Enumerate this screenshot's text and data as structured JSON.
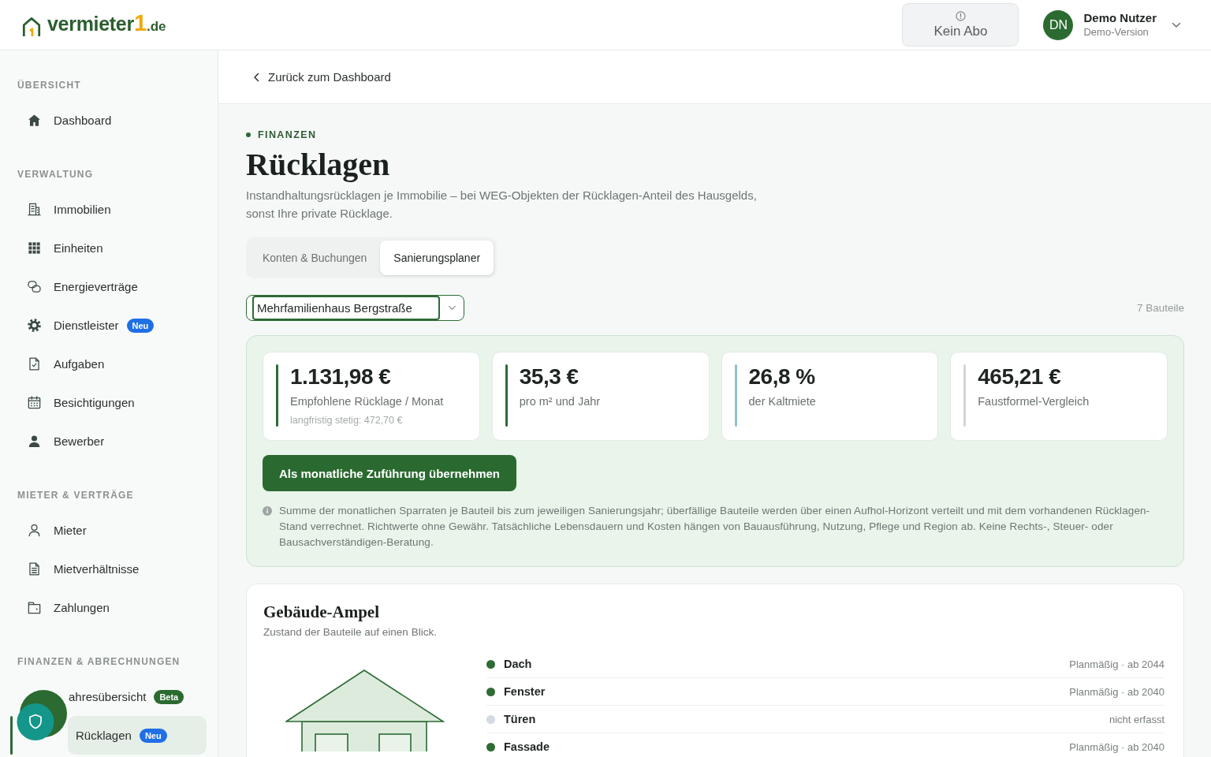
{
  "header": {
    "logo": {
      "name": "vermieter",
      "mark": "1",
      "suffix": ".de"
    },
    "plan_button": "Kein Abo",
    "user": {
      "initials": "DN",
      "name": "Demo Nutzer",
      "role": "Demo-Version"
    }
  },
  "sidebar": {
    "sections": [
      {
        "heading": "ÜBERSICHT",
        "items": [
          {
            "label": "Dashboard",
            "selected": false
          }
        ]
      },
      {
        "heading": "VERWALTUNG",
        "items": [
          {
            "label": "Immobilien",
            "selected": false
          },
          {
            "label": "Einheiten",
            "selected": false
          },
          {
            "label": "Energieverträge",
            "selected": false
          },
          {
            "label": "Dienstleister",
            "selected": false,
            "badge": {
              "text": "Neu",
              "color": "#1f6fe5"
            }
          },
          {
            "label": "Aufgaben",
            "selected": false
          },
          {
            "label": "Besichtigungen",
            "selected": false
          },
          {
            "label": "Bewerber",
            "selected": false
          }
        ]
      },
      {
        "heading": "MIETER & VERTRÄGE",
        "items": [
          {
            "label": "Mieter",
            "selected": false
          },
          {
            "label": "Mietverhältnisse",
            "selected": false
          },
          {
            "label": "Zahlungen",
            "selected": false
          }
        ]
      },
      {
        "heading": "FINANZEN & ABRECHNUNGEN",
        "items": [
          {
            "label": "ahresübersicht",
            "selected": false,
            "badge": {
              "text": "Beta",
              "color": "#2b6a30"
            }
          },
          {
            "label": "Rücklagen",
            "selected": true,
            "badge": {
              "text": "Neu",
              "color": "#1f6fe5"
            }
          }
        ]
      }
    ]
  },
  "back_link": "Zurück zum Dashboard",
  "page": {
    "eyebrow": "FINANZEN",
    "title": "Rücklagen",
    "subtitle": "Instandhaltungsrücklagen je Immobilie – bei WEG-Objekten der Rücklagen-Anteil des Hausgelds, sonst Ihre private Rücklage."
  },
  "tabs": [
    {
      "label": "Konten & Buchungen",
      "selected": false
    },
    {
      "label": "Sanierungsplaner",
      "selected": true
    }
  ],
  "property_select": {
    "value": "Mehrfamilienhaus Bergstraße"
  },
  "component_count": "7 Bauteile",
  "summary": {
    "stats": [
      {
        "value": "1.131,98 €",
        "label": "Empfohlene Rücklage / Monat",
        "note": "langfristig stetig: 472,70 €",
        "color": "#2d6a35"
      },
      {
        "value": "35,3 €",
        "label": "pro m² und Jahr",
        "color": "#2d6a35"
      },
      {
        "value": "26,8 %",
        "label": "der Kaltmiete",
        "color": "#8fc3c9"
      },
      {
        "value": "465,21 €",
        "label": "Faustformel-Vergleich",
        "color": "#d3d6d5"
      }
    ],
    "button": "Als monatliche Zuführung übernehmen",
    "note": "Summe der monatlichen Sparraten je Bauteil bis zum jeweiligen Sanierungsjahr; überfällige Bauteile werden über einen Aufhol-Horizont verteilt und mit dem vorhandenen Rücklagen-Stand verrechnet. Richtwerte ohne Gewähr. Tatsächliche Lebensdauern und Kosten hängen von Bauausführung, Nutzung, Pflege und Region ab. Keine Rechts-, Steuer- oder Bausachverständigen-Beratung."
  },
  "building_status": {
    "title": "Gebäude-Ampel",
    "subtitle": "Zustand der Bauteile auf einen Blick.",
    "components": [
      {
        "name": "Dach",
        "status": "Planmäßig · ab 2044",
        "color": "#2f6b34"
      },
      {
        "name": "Fenster",
        "status": "Planmäßig · ab 2040",
        "color": "#2f6b34"
      },
      {
        "name": "Türen",
        "status": "nicht erfasst",
        "color": "#d5d9e3"
      },
      {
        "name": "Fassade",
        "status": "Planmäßig · ab 2040",
        "color": "#2f6b34"
      }
    ]
  }
}
